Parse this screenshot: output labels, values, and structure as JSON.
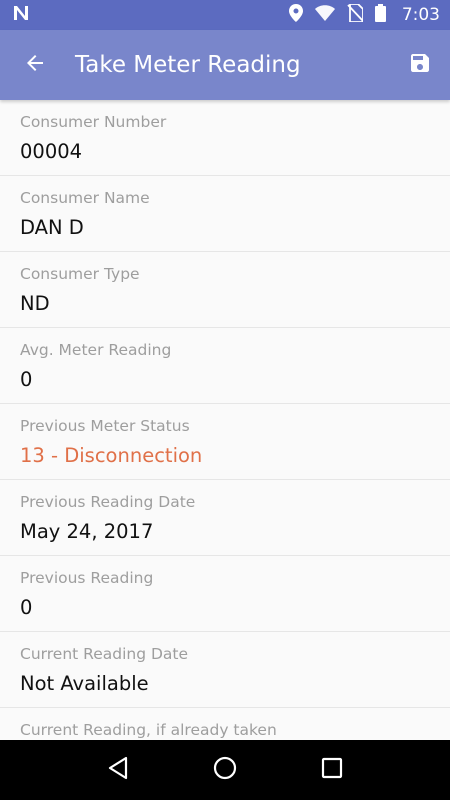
{
  "status_bar": {
    "time": "7:03",
    "icons": [
      "n-notification-icon",
      "location-icon",
      "wifi-icon",
      "no-sim-icon",
      "battery-icon"
    ]
  },
  "app_bar": {
    "title": "Take Meter Reading",
    "back_icon": "arrow-back-icon",
    "save_icon": "save-icon"
  },
  "fields": [
    {
      "label": "Consumer Number",
      "value": "00004"
    },
    {
      "label": "Consumer Name",
      "value": "DAN D"
    },
    {
      "label": "Consumer Type",
      "value": "ND"
    },
    {
      "label": "Avg. Meter Reading",
      "value": "0"
    },
    {
      "label": "Previous Meter Status",
      "value": "13 - Disconnection"
    },
    {
      "label": "Previous Reading Date",
      "value": "May 24, 2017"
    },
    {
      "label": "Previous Reading",
      "value": "0"
    },
    {
      "label": "Current Reading Date",
      "value": "Not Available"
    },
    {
      "label": "Current Reading, if already taken",
      "value": ""
    }
  ],
  "colors": {
    "status_bar": "#5c6bc0",
    "app_bar": "#7986cb",
    "alert_value": "#e07048",
    "label": "#9e9e9e"
  },
  "nav_bar": {
    "icons": [
      "back-triangle-icon",
      "home-circle-icon",
      "recents-square-icon"
    ]
  }
}
